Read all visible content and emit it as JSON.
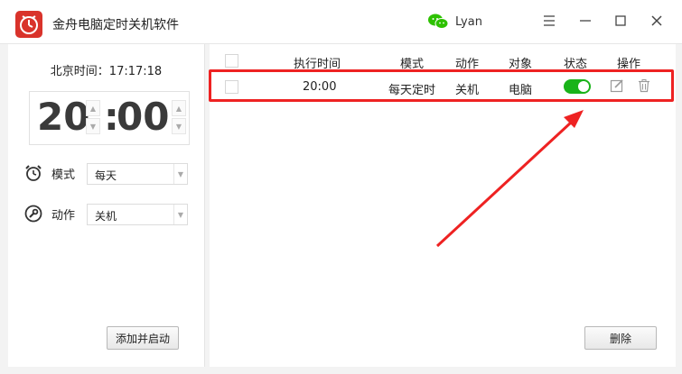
{
  "titlebar": {
    "app_title": "金舟电脑定时关机软件",
    "user_name": "Lyan",
    "minimize_glyph": "—",
    "maximize_glyph": "☐",
    "close_glyph": "✕",
    "menu_glyph": "☰"
  },
  "left": {
    "beijing_time": "北京时间：17:17:18",
    "hour": "20",
    "colon": ":",
    "minute": "00",
    "mode_label": "模式",
    "mode_value": "每天",
    "action_label": "动作",
    "action_value": "关机",
    "add_button": "添加并启动"
  },
  "table": {
    "headers": {
      "time": "执行时间",
      "mode": "模式",
      "action": "动作",
      "target": "对象",
      "status": "状态",
      "ops": "操作"
    },
    "rows": [
      {
        "time": "20:00",
        "mode": "每天定时",
        "action": "关机",
        "target": "电脑",
        "status_on": true
      }
    ]
  },
  "delete_button": "删除",
  "colors": {
    "accent_red": "#ee2222",
    "toggle_green": "#19b319",
    "logo_red": "#d9332b",
    "wechat_green": "#2dc100"
  },
  "icons": [
    "app-logo-icon",
    "wechat-icon",
    "menu-icon",
    "minimize-icon",
    "maximize-icon",
    "close-icon",
    "alarm-clock-icon",
    "wrench-icon",
    "edit-icon",
    "trash-icon",
    "spin-up-icon",
    "spin-down-icon",
    "dropdown-arrow-icon"
  ]
}
